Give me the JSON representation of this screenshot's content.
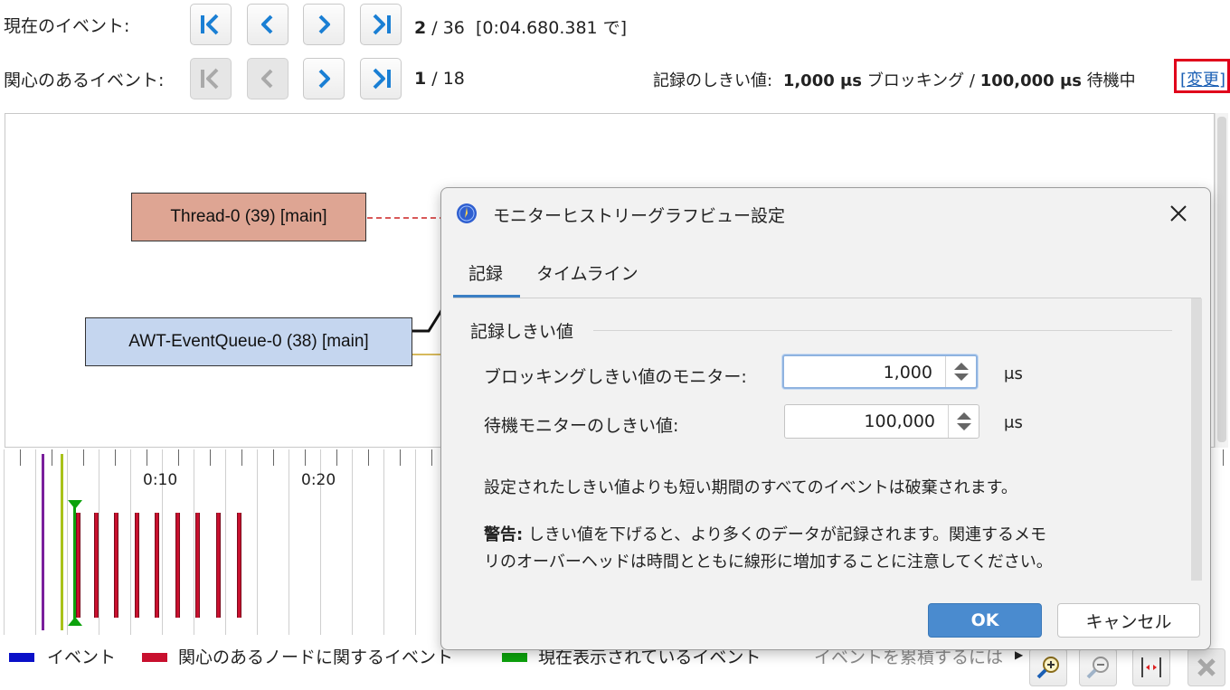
{
  "header": {
    "current_event_label": "現在のイベント:",
    "current_event_index": "2",
    "current_event_total": "/ 36",
    "current_event_time": "[0:04.680.381 で]",
    "interest_event_label": "関心のあるイベント:",
    "interest_event_index": "1",
    "interest_event_total": "/ 18",
    "threshold_label": "記録のしきい値:",
    "threshold_blocking_value": "1,000 μs",
    "threshold_blocking_text": "ブロッキング /",
    "threshold_waiting_value": "100,000 μs",
    "threshold_waiting_text": "待機中",
    "change_link": "[変更]"
  },
  "graph": {
    "nodes": [
      {
        "label": "Thread-0 (39) [main]",
        "color": "#dea593"
      },
      {
        "label": "AWT-EventQueue-0 (38) [main]",
        "color": "#c5d6ef"
      }
    ]
  },
  "timeline": {
    "labels": [
      "0:10",
      "0:20"
    ]
  },
  "legend": {
    "items": [
      {
        "label": "イベント",
        "color": "#0a10c8"
      },
      {
        "label": "関心のあるノードに関するイベント",
        "color": "#c8102e"
      },
      {
        "label": "現在表示されているイベント",
        "color": "#0ca20c"
      }
    ],
    "overflow_text": "イベントを累積するには"
  },
  "dialog": {
    "title": "モニターヒストリーグラフビュー設定",
    "tabs": [
      "記録",
      "タイムライン"
    ],
    "section_title": "記録しきい値",
    "blocking_label": "ブロッキングしきい値のモニター:",
    "blocking_value": "1,000",
    "blocking_unit": "μs",
    "waiting_label": "待機モニターのしきい値:",
    "waiting_value": "100,000",
    "waiting_unit": "μs",
    "description": "設定されたしきい値よりも短い期間のすべてのイベントは破棄されます。",
    "warning_bold": "警告:",
    "warning_line1": "しきい値を下げると、より多くのデータが記録されます。関連するメモ",
    "warning_line2": "リのオーバーヘッドは時間とともに線形に増加することに注意してください。",
    "ok_label": "OK",
    "cancel_label": "キャンセル"
  },
  "colors": {
    "accent": "#3c7fc4",
    "highlight_box": "#e0001b",
    "ok_button": "#4a8bcf"
  }
}
